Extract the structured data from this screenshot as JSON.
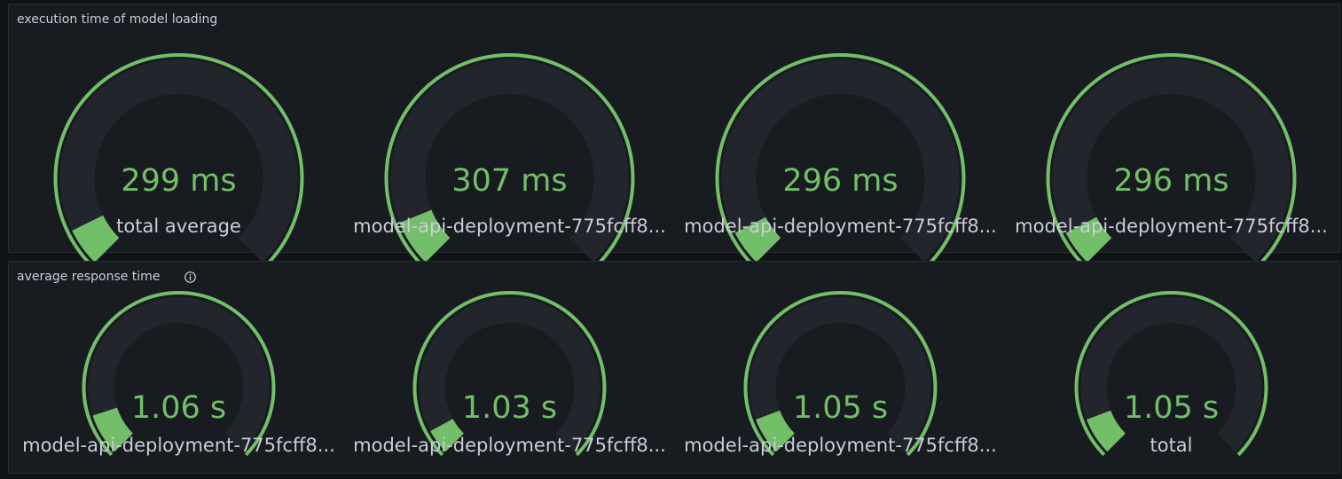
{
  "panels": [
    {
      "title": "execution time of model loading",
      "has_info_icon": false,
      "gauges": [
        {
          "value": "299 ms",
          "label": "total average",
          "fill_fraction": 0.07
        },
        {
          "value": "307 ms",
          "label": "model-api-deployment-775fcff8...",
          "fill_fraction": 0.085
        },
        {
          "value": "296 ms",
          "label": "model-api-deployment-775fcff8...",
          "fill_fraction": 0.065
        },
        {
          "value": "296 ms",
          "label": "model-api-deployment-775fcff8...",
          "fill_fraction": 0.065
        }
      ]
    },
    {
      "title": "average response time",
      "has_info_icon": true,
      "gauges": [
        {
          "value": "1.06 s",
          "label": "model-api-deployment-775fcff8...",
          "fill_fraction": 0.1
        },
        {
          "value": "1.03 s",
          "label": "model-api-deployment-775fcff8...",
          "fill_fraction": 0.06
        },
        {
          "value": "1.05 s",
          "label": "model-api-deployment-775fcff8...",
          "fill_fraction": 0.09
        },
        {
          "value": "1.05 s",
          "label": "total",
          "fill_fraction": 0.09
        }
      ]
    }
  ],
  "colors": {
    "threshold": "#73bf69",
    "value": "#73bf69",
    "track": "#22252b",
    "panel_bg": "#181b1f",
    "text": "#ccccdc"
  },
  "icons": {
    "info": "info-circle-icon"
  }
}
